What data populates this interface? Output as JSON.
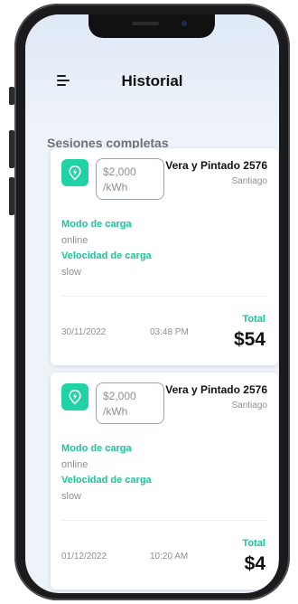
{
  "header": {
    "title": "Historial"
  },
  "section": {
    "title": "Sesiones completas"
  },
  "colors": {
    "accent": "#1fd3a6",
    "label": "#18c49b"
  },
  "sessions": [
    {
      "price": "$2,000",
      "unit": "/kWh",
      "station": "Vera y Pintado 2576",
      "city": "Santiago",
      "mode_label": "Modo de carga",
      "mode_value": "online",
      "speed_label": "Velocidad de carga",
      "speed_value": "slow",
      "date": "30/11/2022",
      "time": "03:48 PM",
      "total_label": "Total",
      "total": "$54"
    },
    {
      "price": "$2,000",
      "unit": "/kWh",
      "station": "Vera y Pintado 2576",
      "city": "Santiago",
      "mode_label": "Modo de carga",
      "mode_value": "online",
      "speed_label": "Velocidad de carga",
      "speed_value": "slow",
      "date": "01/12/2022",
      "time": "10:20 AM",
      "total_label": "Total",
      "total": "$4"
    }
  ]
}
